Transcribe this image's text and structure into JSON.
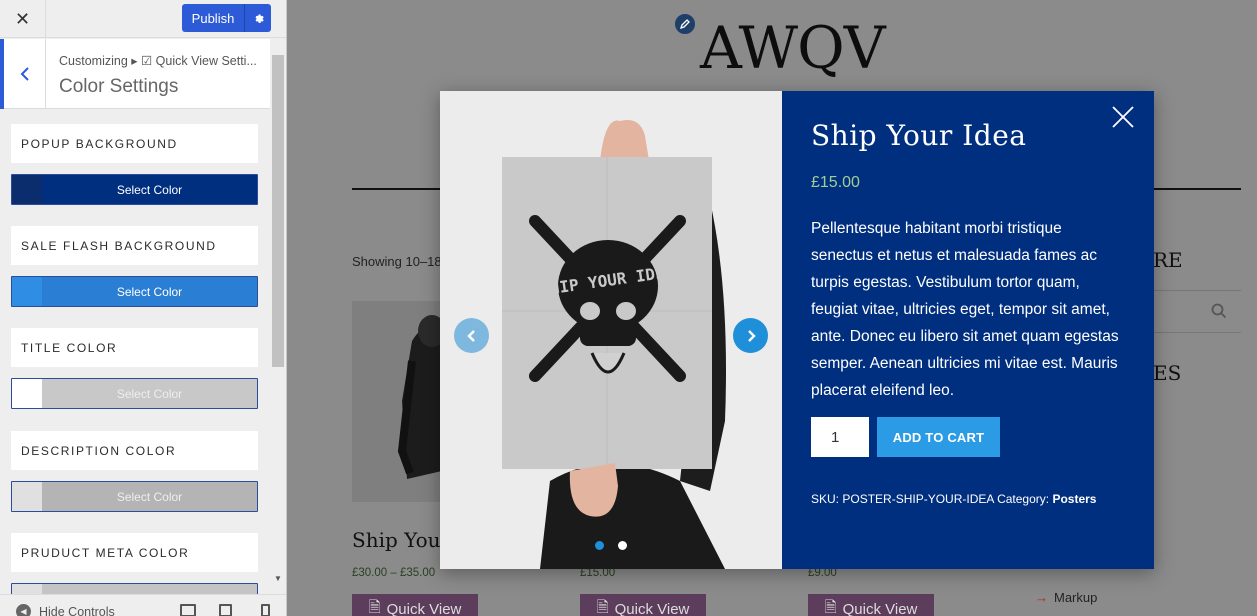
{
  "sidebar": {
    "close_glyph": "✕",
    "publish_label": "Publish",
    "breadcrumb": "Customizing ▸ ☑ Quick View Setti...",
    "panel_title": "Color Settings",
    "controls": [
      {
        "label": "Popup Background",
        "button": "Select Color",
        "swatch": "#0b2d6e",
        "fill": "#002f7f",
        "text_color": "#ffffff"
      },
      {
        "label": "Sale Flash Background",
        "button": "Select Color",
        "swatch": "#2f8ee3",
        "fill": "#2a7fd4",
        "text_color": "#ffffff"
      },
      {
        "label": "Title Color",
        "button": "Select Color",
        "swatch": "#ffffff",
        "fill": "#c8c8c8",
        "text_color": "#eeeeee"
      },
      {
        "label": "Description Color",
        "button": "Select Color",
        "swatch": "#e0e0e0",
        "fill": "#b4b4b4",
        "text_color": "#eeeeee"
      },
      {
        "label": "Pruduct Meta Color",
        "button": "",
        "swatch": "#e0e0e0",
        "fill": "#c4c4c4",
        "text_color": "#eeeeee"
      }
    ],
    "footer": {
      "hide_controls": "Hide Controls"
    }
  },
  "preview": {
    "site_title": "AWQV",
    "showing_text": "Showing 10–18",
    "sidebar_heading_1": "RE",
    "sidebar_heading_2": "ES",
    "products": [
      {
        "name": "Ship Your",
        "price": "£30.00 – £35.00",
        "button": "Quick View"
      },
      {
        "name": "",
        "price": "£15.00",
        "button": "Quick View"
      },
      {
        "name": "",
        "price": "£9.00",
        "button": "Quick View"
      }
    ],
    "markup_link": "Markup"
  },
  "modal": {
    "title": "Ship Your Idea",
    "price": "£15.00",
    "description": "Pellentesque habitant morbi tristique senectus et netus et malesuada fames ac turpis egestas. Vestibulum tortor quam, feugiat vitae, ultricies eget, tempor sit amet, ante. Donec eu libero sit amet quam egestas semper. Aenean ultricies mi vitae est. Mauris placerat eleifend leo.",
    "quantity": "1",
    "add_to_cart": "ADD TO CART",
    "sku_label": "SKU:",
    "sku": "POSTER-SHIP-YOUR-IDEA",
    "category_label": "Category:",
    "category": "Posters",
    "poster_text": "SHIP YOUR IDEA",
    "slides_total": 2,
    "slide_active": 1,
    "colors": {
      "background": "#002f7f",
      "price": "#9fcf93",
      "button": "#2a9be4"
    }
  },
  "icons": [
    "close-icon",
    "gear-icon",
    "chevron-left-icon",
    "pencil-icon",
    "search-icon",
    "chevron-left-icon",
    "chevron-right-icon",
    "document-icon",
    "arrow-right-icon",
    "desktop-icon",
    "tablet-icon",
    "mobile-icon"
  ]
}
